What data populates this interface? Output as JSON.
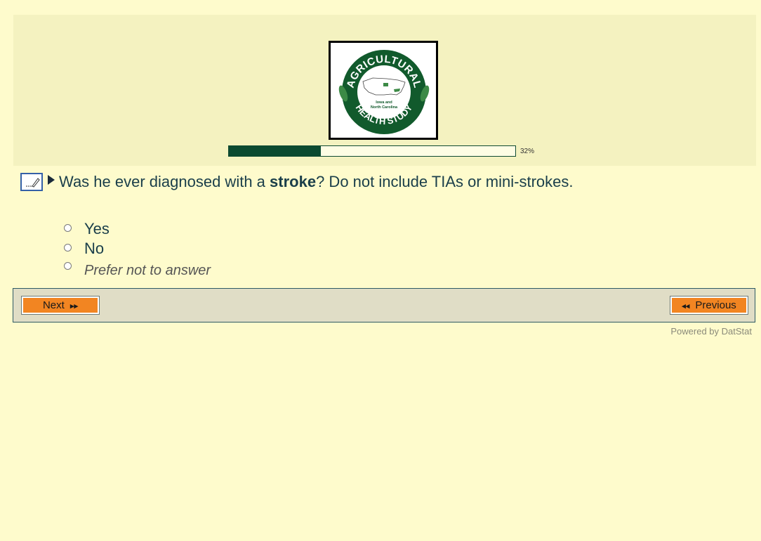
{
  "header": {
    "logo": {
      "ring_top_text": "AGRICULTURAL",
      "ring_bottom_text": "HEALTH STUDY",
      "center_line1": "Iowa and",
      "center_line2": "North Carolina"
    },
    "progress": {
      "percent": 32,
      "label": "32%"
    }
  },
  "question": {
    "text_before": "Was he ever diagnosed with a ",
    "text_bold": "stroke",
    "text_after": "?  Do not include TIAs or mini-strokes.",
    "options": [
      {
        "label": "Yes"
      },
      {
        "label": "No"
      },
      {
        "label": "Prefer not to answer"
      }
    ]
  },
  "nav": {
    "next_label": "Next",
    "next_icon": "double-chevron-right-icon",
    "previous_label": "Previous",
    "previous_icon": "double-chevron-left-icon"
  },
  "footer": {
    "powered_by": "Powered by DatStat"
  },
  "colors": {
    "page_bg": "#fefbcc",
    "header_bg": "#f4f2c0",
    "progress_fill": "#0b4a30",
    "button_orange": "#f28522",
    "nav_bar_bg": "#e0ddc6",
    "question_text": "#1a3e4a"
  }
}
